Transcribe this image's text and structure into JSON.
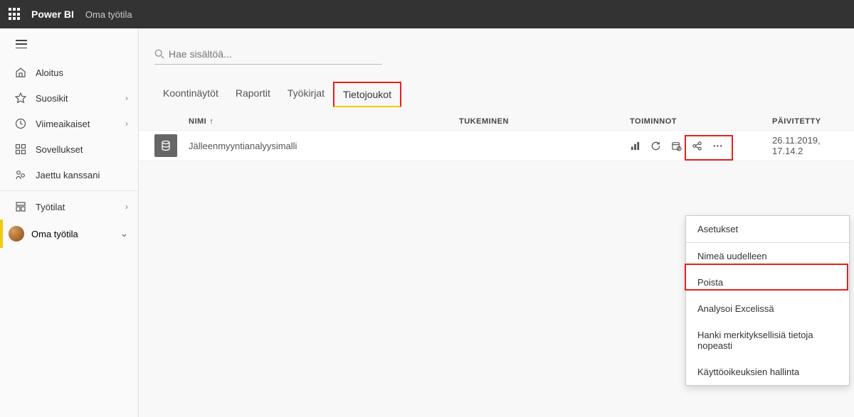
{
  "topbar": {
    "brand": "Power BI",
    "workspace": "Oma työtila"
  },
  "sidebar": {
    "items": [
      {
        "label": "Aloitus",
        "icon": "home",
        "chev": false
      },
      {
        "label": "Suosikit",
        "icon": "star",
        "chev": true
      },
      {
        "label": "Viimeaikaiset",
        "icon": "clock",
        "chev": true
      },
      {
        "label": "Sovellukset",
        "icon": "apps",
        "chev": false
      },
      {
        "label": "Jaettu kanssani",
        "icon": "share",
        "chev": false
      },
      {
        "label": "Työtilat",
        "icon": "workspaces",
        "chev": true
      }
    ],
    "workspace_label": "Oma työtila"
  },
  "search": {
    "placeholder": "Hae sisältöä..."
  },
  "tabs": [
    "Koontinäytöt",
    "Raportit",
    "Työkirjat",
    "Tietojoukot"
  ],
  "active_tab_index": 3,
  "columns": {
    "name": "NIMI",
    "support": "TUKEMINEN",
    "actions": "TOIMINNOT",
    "updated": "PÄIVITETTY"
  },
  "sort_arrow": "↑",
  "row": {
    "name": "Jälleenmyyntianalyysimalli",
    "updated": "26.11.2019, 17.14.2"
  },
  "menu": [
    "Asetukset",
    "Nimeä uudelleen",
    "Poista",
    "Analysoi Excelissä",
    "Hanki merkityksellisiä tietoja nopeasti",
    "Käyttöoikeuksien hallinta"
  ]
}
